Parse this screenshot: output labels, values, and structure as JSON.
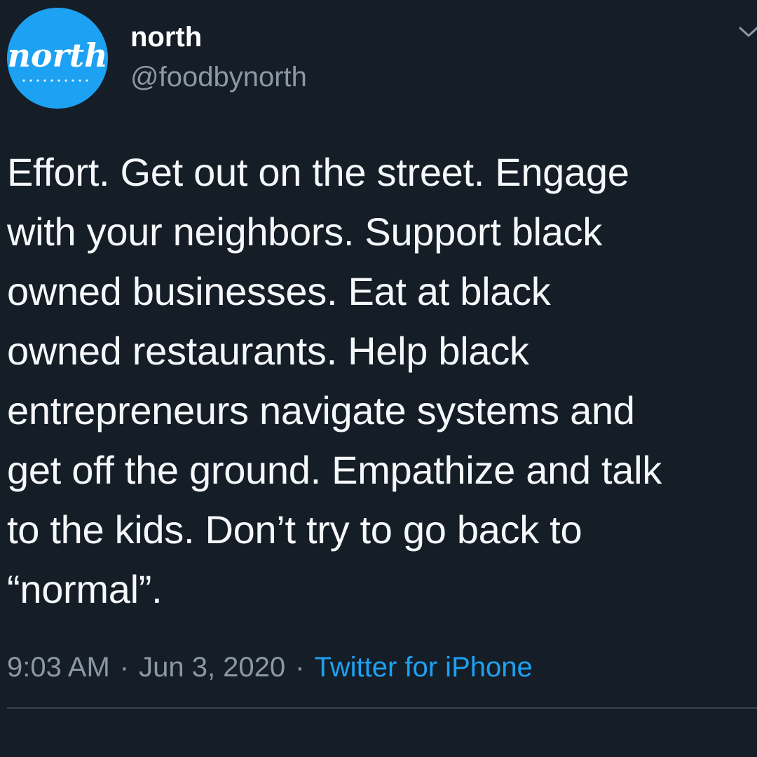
{
  "author": {
    "display_name": "north",
    "handle": "@foodbynorth",
    "avatar_text": "north",
    "avatar_color": "#1da1f2"
  },
  "tweet": {
    "lines": [
      "Effort. Get out on the street. Engage",
      "with your neighbors. Support black",
      "owned businesses. Eat at black",
      "owned restaurants. Help black",
      "entrepreneurs navigate systems and",
      "get off the ground. Empathize and talk",
      "to the kids. Don’t try to go back to",
      "“normal”."
    ]
  },
  "meta": {
    "time": "9:03 AM",
    "separator": "·",
    "date": "Jun 3, 2020",
    "source": "Twitter for iPhone"
  },
  "colors": {
    "background": "#151d27",
    "text": "#f5f8fa",
    "secondary": "#8b98a5",
    "accent": "#1da1f2",
    "divider": "#38444d"
  },
  "icons": {
    "menu": "chevron-down-icon"
  }
}
